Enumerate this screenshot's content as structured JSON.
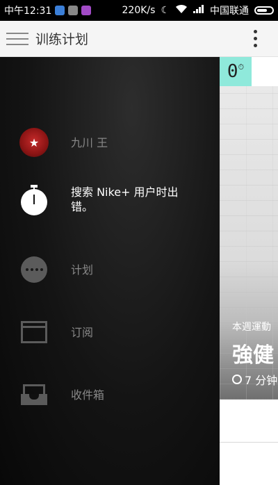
{
  "status_bar": {
    "time": "中午12:31",
    "speed": "220K/s",
    "moon": "☾",
    "carrier": "中国联通"
  },
  "app_bar": {
    "title": "训练计划"
  },
  "badge": {
    "value": "0",
    "sup": "⏱"
  },
  "hero": {
    "subtitle": "本週運動",
    "title": "強健",
    "duration": "7 分钟"
  },
  "drawer": {
    "items": [
      {
        "label": "九川 王",
        "icon": "avatar"
      },
      {
        "label": "搜索 Nike+ 用户时出错。",
        "icon": "stopwatch-icon"
      },
      {
        "label": "计划",
        "icon": "more-dots-icon"
      },
      {
        "label": "订阅",
        "icon": "window-icon"
      },
      {
        "label": "收件箱",
        "icon": "inbox-icon"
      }
    ]
  },
  "colors": {
    "badge": "#8fe9db",
    "drawer_bg": "#141414",
    "app_bar_bg": "#f5f5f5"
  }
}
